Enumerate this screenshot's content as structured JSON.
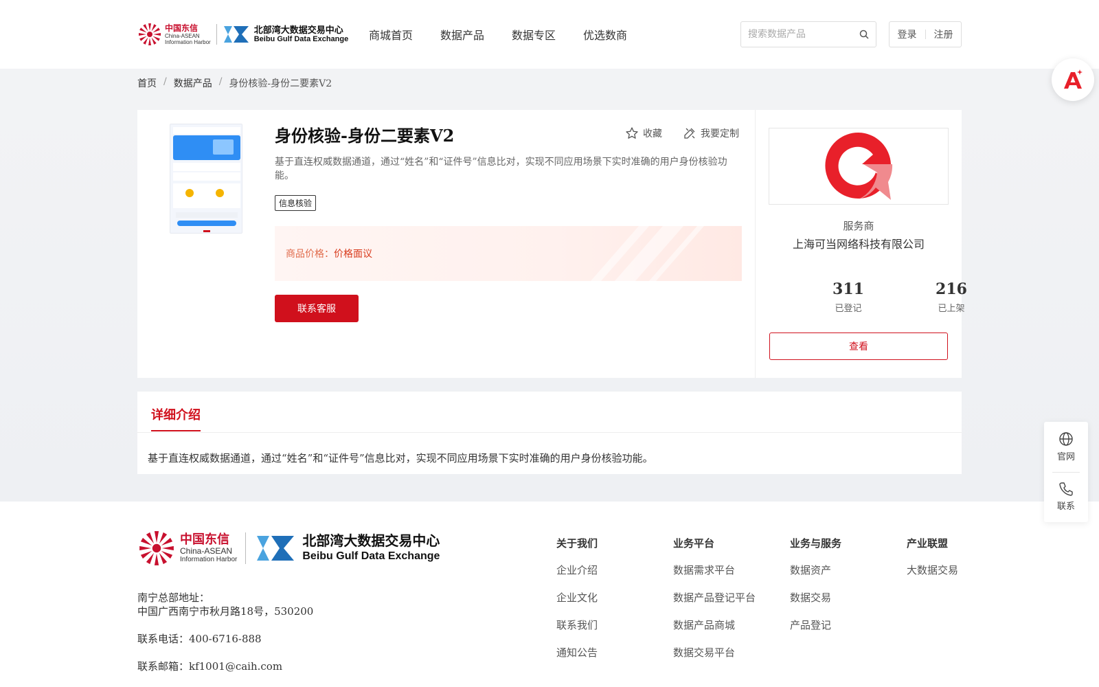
{
  "header": {
    "logo": {
      "cn_brand_cn": "中国东信",
      "cn_brand_en1": "China-ASEAN",
      "cn_brand_en2": "Information Harbor",
      "bbg_cn": "北部湾大数据交易中心",
      "bbg_en": "Beibu Gulf Data Exchange"
    },
    "nav": [
      "商城首页",
      "数据产品",
      "数据专区",
      "优选数商"
    ],
    "search": {
      "placeholder": "搜索数据产品"
    },
    "login": "登录",
    "register": "注册"
  },
  "breadcrumb": [
    "首页",
    "数据产品",
    "身份核验-身份二要素V2"
  ],
  "product": {
    "title": "身份核验-身份二要素V2",
    "favorite": "收藏",
    "customize": "我要定制",
    "description": "基于直连权威数据通道，通过“姓名”和“证件号”信息比对，实现不同应用场景下实时准确的用户身份核验功能。",
    "tag": "信息核验",
    "price_label": "商品价格：",
    "price_value": "价格面议",
    "contact_button": "联系客服"
  },
  "vendor": {
    "label": "服务商",
    "name": "上海可当网络科技有限公司",
    "stats": [
      {
        "value": "311",
        "label": "已登记"
      },
      {
        "value": "216",
        "label": "已上架"
      }
    ],
    "view_button": "查看"
  },
  "detail": {
    "tab": "详细介绍",
    "text": "基于直连权威数据通道，通过“姓名”和“证件号”信息比对，实现不同应用场景下实时准确的用户身份核验功能。"
  },
  "footer": {
    "address_label": "南宁总部地址：",
    "address": "中国广西南宁市秋月路18号，530200",
    "phone": "联系电话：400-6716-888",
    "email": "联系邮箱：kf1001@caih.com",
    "columns": [
      {
        "title": "关于我们",
        "items": [
          "企业介绍",
          "企业文化",
          "联系我们",
          "通知公告"
        ]
      },
      {
        "title": "业务平台",
        "items": [
          "数据需求平台",
          "数据产品登记平台",
          "数据产品商城",
          "数据交易平台"
        ]
      },
      {
        "title": "业务与服务",
        "items": [
          "数据资产",
          "数据交易",
          "产品登记"
        ]
      },
      {
        "title": "产业联盟",
        "items": [
          "大数据交易"
        ]
      }
    ]
  },
  "floating": {
    "website": "官网",
    "contact": "联系"
  },
  "colors": {
    "brand_red": "#d0101c",
    "price_orange": "#d8391b"
  }
}
